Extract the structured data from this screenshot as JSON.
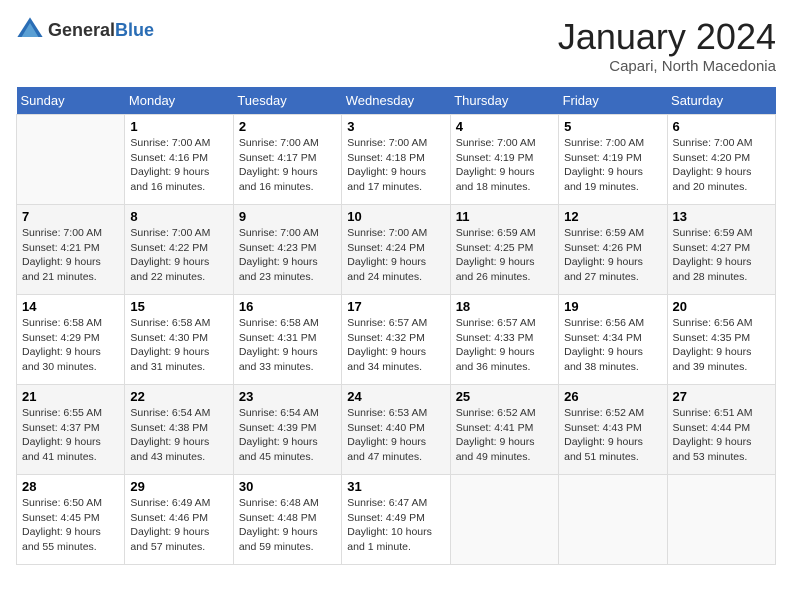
{
  "header": {
    "logo_general": "General",
    "logo_blue": "Blue",
    "month": "January 2024",
    "location": "Capari, North Macedonia"
  },
  "days_of_week": [
    "Sunday",
    "Monday",
    "Tuesday",
    "Wednesday",
    "Thursday",
    "Friday",
    "Saturday"
  ],
  "weeks": [
    [
      {
        "day": "",
        "info": ""
      },
      {
        "day": "1",
        "info": "Sunrise: 7:00 AM\nSunset: 4:16 PM\nDaylight: 9 hours\nand 16 minutes."
      },
      {
        "day": "2",
        "info": "Sunrise: 7:00 AM\nSunset: 4:17 PM\nDaylight: 9 hours\nand 16 minutes."
      },
      {
        "day": "3",
        "info": "Sunrise: 7:00 AM\nSunset: 4:18 PM\nDaylight: 9 hours\nand 17 minutes."
      },
      {
        "day": "4",
        "info": "Sunrise: 7:00 AM\nSunset: 4:19 PM\nDaylight: 9 hours\nand 18 minutes."
      },
      {
        "day": "5",
        "info": "Sunrise: 7:00 AM\nSunset: 4:19 PM\nDaylight: 9 hours\nand 19 minutes."
      },
      {
        "day": "6",
        "info": "Sunrise: 7:00 AM\nSunset: 4:20 PM\nDaylight: 9 hours\nand 20 minutes."
      }
    ],
    [
      {
        "day": "7",
        "info": "Sunrise: 7:00 AM\nSunset: 4:21 PM\nDaylight: 9 hours\nand 21 minutes."
      },
      {
        "day": "8",
        "info": "Sunrise: 7:00 AM\nSunset: 4:22 PM\nDaylight: 9 hours\nand 22 minutes."
      },
      {
        "day": "9",
        "info": "Sunrise: 7:00 AM\nSunset: 4:23 PM\nDaylight: 9 hours\nand 23 minutes."
      },
      {
        "day": "10",
        "info": "Sunrise: 7:00 AM\nSunset: 4:24 PM\nDaylight: 9 hours\nand 24 minutes."
      },
      {
        "day": "11",
        "info": "Sunrise: 6:59 AM\nSunset: 4:25 PM\nDaylight: 9 hours\nand 26 minutes."
      },
      {
        "day": "12",
        "info": "Sunrise: 6:59 AM\nSunset: 4:26 PM\nDaylight: 9 hours\nand 27 minutes."
      },
      {
        "day": "13",
        "info": "Sunrise: 6:59 AM\nSunset: 4:27 PM\nDaylight: 9 hours\nand 28 minutes."
      }
    ],
    [
      {
        "day": "14",
        "info": "Sunrise: 6:58 AM\nSunset: 4:29 PM\nDaylight: 9 hours\nand 30 minutes."
      },
      {
        "day": "15",
        "info": "Sunrise: 6:58 AM\nSunset: 4:30 PM\nDaylight: 9 hours\nand 31 minutes."
      },
      {
        "day": "16",
        "info": "Sunrise: 6:58 AM\nSunset: 4:31 PM\nDaylight: 9 hours\nand 33 minutes."
      },
      {
        "day": "17",
        "info": "Sunrise: 6:57 AM\nSunset: 4:32 PM\nDaylight: 9 hours\nand 34 minutes."
      },
      {
        "day": "18",
        "info": "Sunrise: 6:57 AM\nSunset: 4:33 PM\nDaylight: 9 hours\nand 36 minutes."
      },
      {
        "day": "19",
        "info": "Sunrise: 6:56 AM\nSunset: 4:34 PM\nDaylight: 9 hours\nand 38 minutes."
      },
      {
        "day": "20",
        "info": "Sunrise: 6:56 AM\nSunset: 4:35 PM\nDaylight: 9 hours\nand 39 minutes."
      }
    ],
    [
      {
        "day": "21",
        "info": "Sunrise: 6:55 AM\nSunset: 4:37 PM\nDaylight: 9 hours\nand 41 minutes."
      },
      {
        "day": "22",
        "info": "Sunrise: 6:54 AM\nSunset: 4:38 PM\nDaylight: 9 hours\nand 43 minutes."
      },
      {
        "day": "23",
        "info": "Sunrise: 6:54 AM\nSunset: 4:39 PM\nDaylight: 9 hours\nand 45 minutes."
      },
      {
        "day": "24",
        "info": "Sunrise: 6:53 AM\nSunset: 4:40 PM\nDaylight: 9 hours\nand 47 minutes."
      },
      {
        "day": "25",
        "info": "Sunrise: 6:52 AM\nSunset: 4:41 PM\nDaylight: 9 hours\nand 49 minutes."
      },
      {
        "day": "26",
        "info": "Sunrise: 6:52 AM\nSunset: 4:43 PM\nDaylight: 9 hours\nand 51 minutes."
      },
      {
        "day": "27",
        "info": "Sunrise: 6:51 AM\nSunset: 4:44 PM\nDaylight: 9 hours\nand 53 minutes."
      }
    ],
    [
      {
        "day": "28",
        "info": "Sunrise: 6:50 AM\nSunset: 4:45 PM\nDaylight: 9 hours\nand 55 minutes."
      },
      {
        "day": "29",
        "info": "Sunrise: 6:49 AM\nSunset: 4:46 PM\nDaylight: 9 hours\nand 57 minutes."
      },
      {
        "day": "30",
        "info": "Sunrise: 6:48 AM\nSunset: 4:48 PM\nDaylight: 9 hours\nand 59 minutes."
      },
      {
        "day": "31",
        "info": "Sunrise: 6:47 AM\nSunset: 4:49 PM\nDaylight: 10 hours\nand 1 minute."
      },
      {
        "day": "",
        "info": ""
      },
      {
        "day": "",
        "info": ""
      },
      {
        "day": "",
        "info": ""
      }
    ]
  ]
}
